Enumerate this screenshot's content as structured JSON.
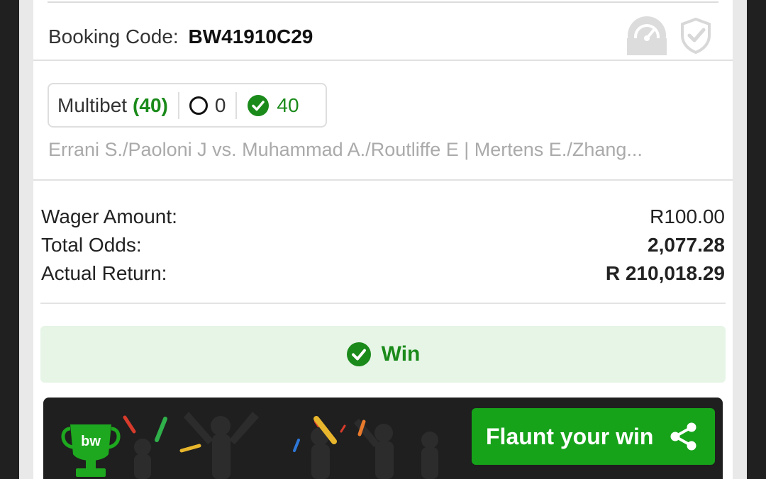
{
  "booking": {
    "label": "Booking Code:",
    "code": "BW41910C29"
  },
  "multibet": {
    "label": "Multibet",
    "count": "(40)",
    "open": "0",
    "won": "40"
  },
  "events_summary": "Errani S./Paoloni J vs. Muhammad A./Routliffe E | Mertens E./Zhang...",
  "summary": {
    "wager_label": "Wager Amount:",
    "wager_value": "R100.00",
    "odds_label": "Total Odds:",
    "odds_value": "2,077.28",
    "return_label": "Actual Return:",
    "return_value": "R 210,018.29"
  },
  "status": {
    "label": "Win"
  },
  "flaunt": {
    "button_label": "Flaunt your win",
    "logo_text": "bw"
  },
  "colors": {
    "accent_green": "#16a31a",
    "win_banner_bg": "#e6f5e6",
    "dark_bar": "#1f1f1f"
  }
}
